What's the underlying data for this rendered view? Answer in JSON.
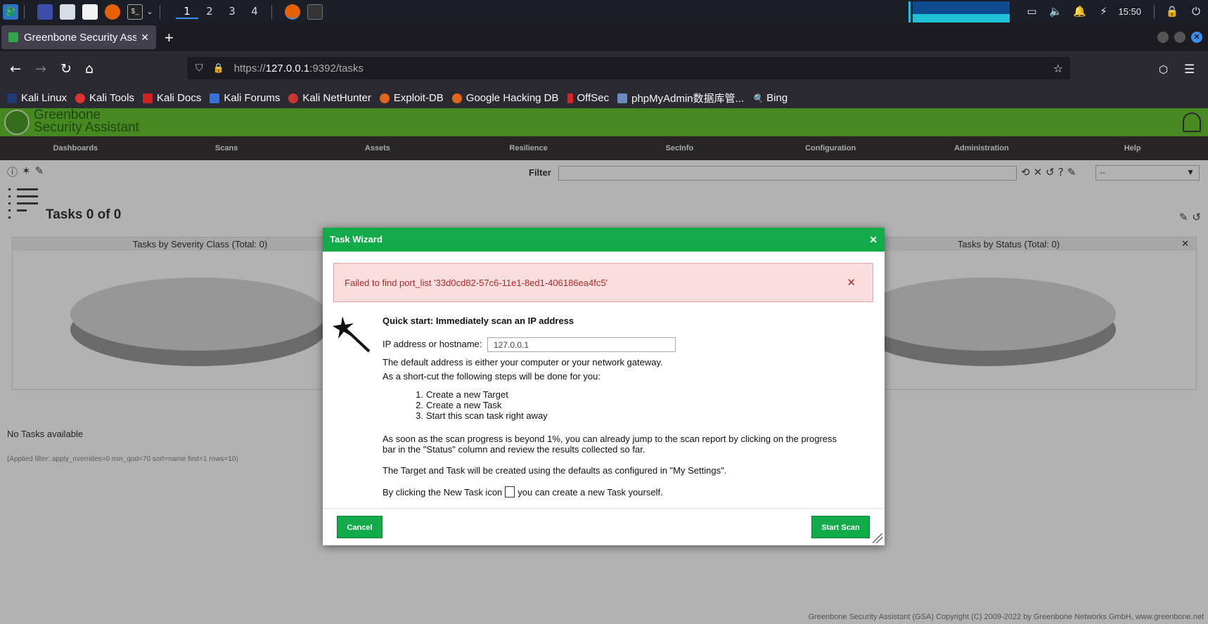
{
  "os": {
    "workspaces": [
      "1",
      "2",
      "3",
      "4"
    ],
    "clock": "15:50"
  },
  "browser": {
    "tab_title": "Greenbone Security Assist",
    "url_host": "127.0.0.1",
    "url_prefix": "https://",
    "url_suffix": ":9392/tasks",
    "bookmarks": [
      "Kali Linux",
      "Kali Tools",
      "Kali Docs",
      "Kali Forums",
      "Kali NetHunter",
      "Exploit-DB",
      "Google Hacking DB",
      "OffSec",
      "phpMyAdmin数据库管...",
      "Bing"
    ]
  },
  "gsa": {
    "logo_line1": "Greenbone",
    "logo_line2": "Security Assistant",
    "menu": [
      "Dashboards",
      "Scans",
      "Assets",
      "Resilience",
      "SecInfo",
      "Configuration",
      "Administration",
      "Help"
    ],
    "filter_label": "Filter",
    "filter_select": "--",
    "tasks_title": "Tasks 0 of 0",
    "chart_left_title": "Tasks by Severity Class (Total: 0)",
    "chart_right_title": "Tasks by Status (Total: 0)",
    "no_tasks": "No Tasks available",
    "applied_filter": "(Applied filter: apply_overrides=0 min_qod=70 sort=name first=1 rows=10)",
    "copyright": "Greenbone Security Assistant (GSA) Copyright (C) 2009-2022 by Greenbone Networks GmbH, www.greenbone.net"
  },
  "dialog": {
    "title": "Task Wizard",
    "error": "Failed to find port_list '33d0cd82-57c6-11e1-8ed1-406186ea4fc5'",
    "quick_start": "Quick start: Immediately scan an IP address",
    "ip_label": "IP address or hostname:",
    "ip_value": "127.0.0.1",
    "default_note": "The default address is either your computer or your network gateway.",
    "shortcut_note": "As a short-cut the following steps will be done for you:",
    "steps": [
      "Create a new Target",
      "Create a new Task",
      "Start this scan task right away"
    ],
    "progress_note_1": "As soon as the scan progress is beyond 1%, you can already jump to the scan report by clicking on the progress",
    "progress_note_2": "bar in the \"Status\" column and review the results collected so far.",
    "settings_note": "The Target and Task will be created using the defaults as configured in \"My Settings\".",
    "newtask_note_a": "By clicking the New Task icon",
    "newtask_note_b": "you can create a new Task yourself.",
    "cancel_label": "Cancel",
    "start_label": "Start Scan"
  }
}
